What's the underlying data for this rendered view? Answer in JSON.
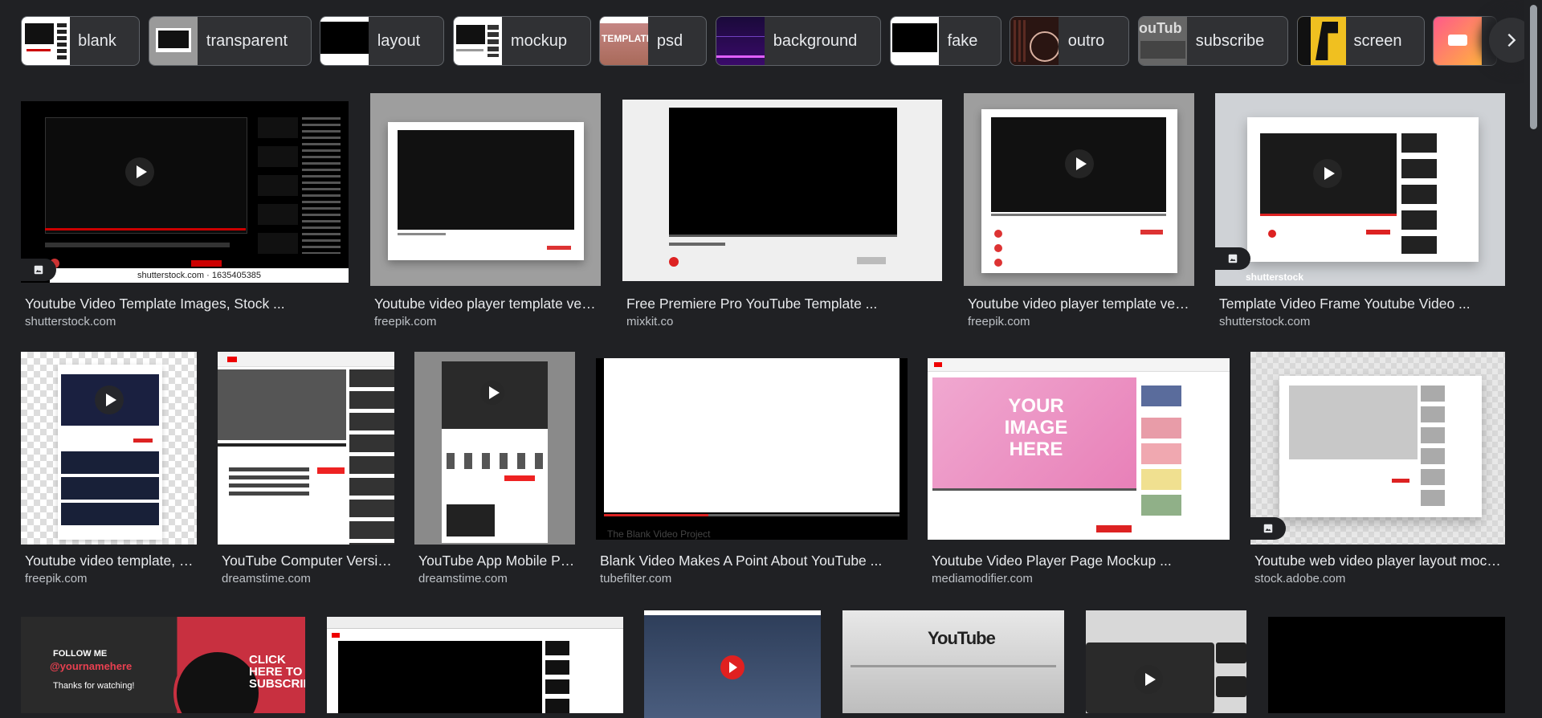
{
  "chips": [
    {
      "label": "blank"
    },
    {
      "label": "transparent"
    },
    {
      "label": "layout"
    },
    {
      "label": "mockup"
    },
    {
      "label": "psd",
      "thumb_text": "TEMPLATE"
    },
    {
      "label": "background"
    },
    {
      "label": "fake"
    },
    {
      "label": "outro"
    },
    {
      "label": "subscribe",
      "thumb_text": "ouTub"
    },
    {
      "label": "screen"
    },
    {
      "label": ""
    }
  ],
  "results": [
    {
      "title": "Youtube Video Template Images, Stock ...",
      "source": "shutterstock.com",
      "watermark": "shutterstock.com · 1635405385"
    },
    {
      "title": "Youtube video player template vect...",
      "source": "freepik.com"
    },
    {
      "title": "Free Premiere Pro YouTube Template ...",
      "source": "mixkit.co"
    },
    {
      "title": "Youtube video player template vect...",
      "source": "freepik.com"
    },
    {
      "title": "Template Video Frame Youtube Video ...",
      "source": "shutterstock.com",
      "watermark": "shutterstock"
    },
    {
      "title": "Youtube video template, vi...",
      "source": "freepik.com"
    },
    {
      "title": "YouTube Computer Versio...",
      "source": "dreamstime.com"
    },
    {
      "title": "YouTube App Mobile Ph...",
      "source": "dreamstime.com"
    },
    {
      "title": "Blank Video Makes A Point About YouTube ...",
      "source": "tubefilter.com",
      "overlay": "The Blank Video Project"
    },
    {
      "title": "Youtube Video Player Page Mockup ...",
      "source": "mediamodifier.com",
      "overlay": "YOUR IMAGE HERE"
    },
    {
      "title": "Youtube web video player layout mocku...",
      "source": "stock.adobe.com"
    },
    {
      "title": "",
      "source": "",
      "overlay_follow": "FOLLOW ME",
      "overlay_handle": "@yournamehere",
      "overlay_thanks": "Thanks for watching!",
      "overlay_cta": "CLICK HERE TO SUBSCRIBE"
    },
    {
      "title": "",
      "source": ""
    },
    {
      "title": "",
      "source": ""
    },
    {
      "title": "",
      "source": "",
      "overlay": "YouTube"
    },
    {
      "title": "",
      "source": ""
    },
    {
      "title": "",
      "source": ""
    }
  ],
  "colors": {
    "background": "#202124",
    "chip_bg": "#303134",
    "chip_border": "#5f6368",
    "text": "#e8eaed",
    "source_text": "#bdc1c6",
    "yt_red": "#ff0000"
  }
}
